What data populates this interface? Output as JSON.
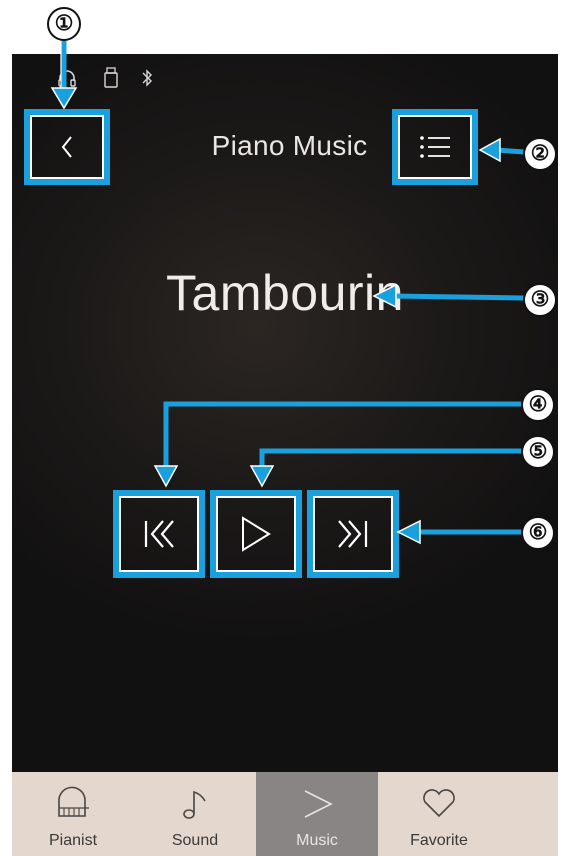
{
  "header": {
    "title": "Piano Music"
  },
  "player": {
    "song_title": "Tambourin"
  },
  "tabs": [
    {
      "label": "Pianist",
      "icon": "piano-icon",
      "active": false
    },
    {
      "label": "Sound",
      "icon": "music-note-icon",
      "active": false
    },
    {
      "label": "Music",
      "icon": "play-icon",
      "active": true
    },
    {
      "label": "Favorite",
      "icon": "heart-icon",
      "active": false
    }
  ],
  "callouts": [
    "①",
    "②",
    "③",
    "④",
    "⑤",
    "⑥"
  ],
  "colors": {
    "highlight": "#1aa0dc",
    "screen_bg": "#141313",
    "tabbar_bg": "#e4d7cd",
    "active_tab_bg": "#888584"
  }
}
